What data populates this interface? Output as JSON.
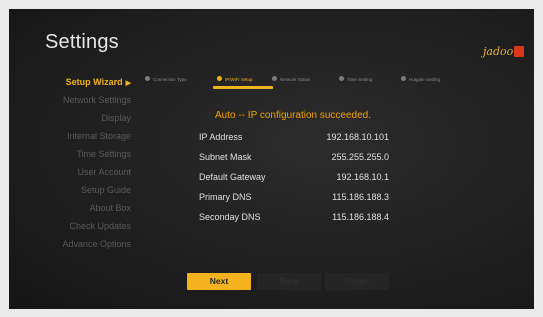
{
  "app": {
    "title": "Settings",
    "logo_text": "jadoo"
  },
  "sidebar": {
    "items": [
      {
        "label": "Setup Wizard",
        "active": true
      },
      {
        "label": "Network Settings"
      },
      {
        "label": "Display"
      },
      {
        "label": "Internal Storage"
      },
      {
        "label": "Time Settings"
      },
      {
        "label": "User Account"
      },
      {
        "label": "Setup Guide"
      },
      {
        "label": "About Box"
      },
      {
        "label": "Check Updates"
      },
      {
        "label": "Advance Options"
      }
    ]
  },
  "wizard": {
    "steps": [
      {
        "label": "Connection Type"
      },
      {
        "label": "IP/WiFi Setup",
        "active": true
      },
      {
        "label": "Network Status"
      },
      {
        "label": "Time Setting"
      },
      {
        "label": "Hotgate Setting"
      }
    ],
    "status": "Auto -- IP configuration succeeded.",
    "info": [
      {
        "label": "IP Address",
        "value": "192.168.10.101"
      },
      {
        "label": "Subnet Mask",
        "value": "255.255.255.0"
      },
      {
        "label": "Default Gateway",
        "value": "192.168.10.1"
      },
      {
        "label": "Primary DNS",
        "value": "115.186.188.3"
      },
      {
        "label": "Seconday DNS",
        "value": "115.186.188.4"
      }
    ],
    "buttons": {
      "next": "Next",
      "back": "Back",
      "forget": "Forget"
    }
  },
  "colors": {
    "accent": "#f0b21e",
    "status": "#f0a000",
    "background": "#1f1f1f"
  }
}
